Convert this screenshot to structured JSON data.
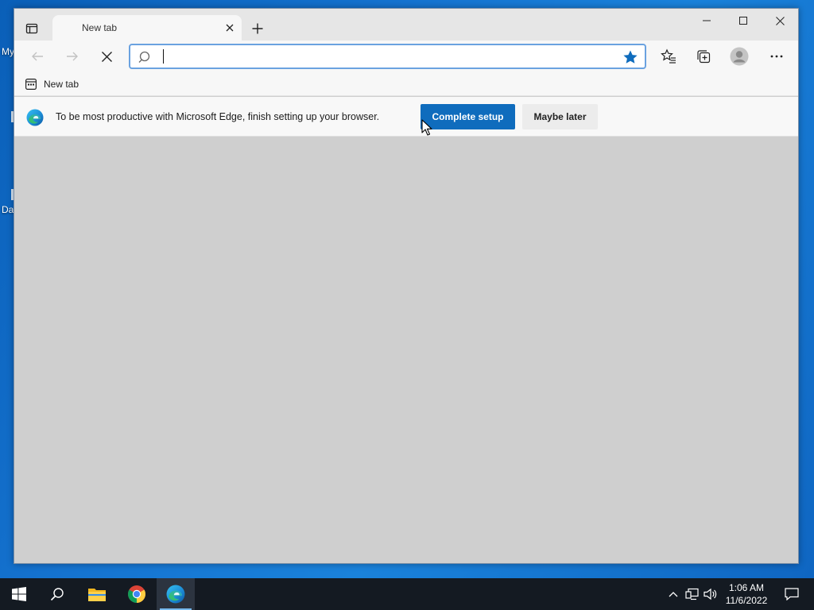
{
  "desktop": {
    "icon_labels": [
      "My",
      "Da"
    ]
  },
  "browser": {
    "tab": {
      "title": "New tab"
    },
    "address_bar": {
      "value": "",
      "placeholder": ""
    },
    "favorites_bar": {
      "items": [
        {
          "label": "New tab"
        }
      ]
    },
    "infobar": {
      "message": "To be most productive with Microsoft Edge, finish setting up your browser.",
      "primary_button": "Complete setup",
      "secondary_button": "Maybe later"
    },
    "colors": {
      "accent": "#0f6cbd",
      "content_bg": "#cfcfcf",
      "chrome_bg": "#f7f7f7"
    }
  },
  "taskbar": {
    "apps": [
      "start-icon",
      "search-icon",
      "file-explorer-icon",
      "chrome-icon",
      "edge-icon"
    ],
    "clock": {
      "time": "1:06 AM",
      "date": "11/6/2022"
    }
  }
}
